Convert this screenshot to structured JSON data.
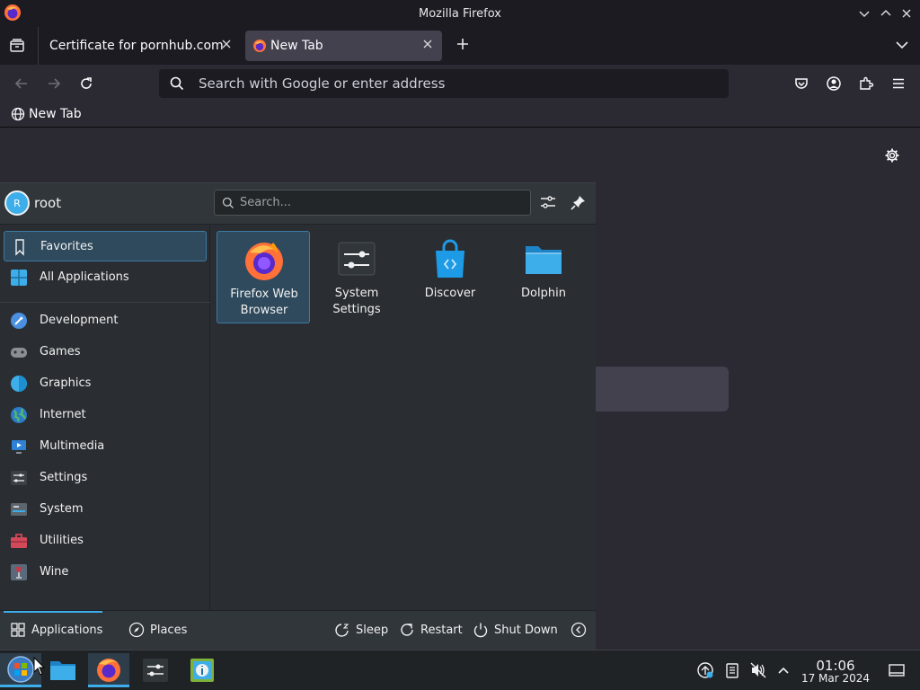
{
  "window": {
    "title": "Mozilla Firefox"
  },
  "tabs": [
    {
      "label": "Certificate for pornhub.com",
      "active": false
    },
    {
      "label": "New Tab",
      "active": true
    }
  ],
  "urlbar": {
    "placeholder": "Search with Google or enter address",
    "value": ""
  },
  "bookmarks": [
    {
      "label": "New Tab"
    }
  ],
  "launcher": {
    "user": {
      "initial": "R",
      "name": "root"
    },
    "search": {
      "placeholder": "Search..."
    },
    "categories": [
      {
        "label": "Favorites",
        "icon": "bookmark-icon",
        "selected": true
      },
      {
        "label": "All Applications",
        "icon": "grid-icon"
      },
      {
        "label": "Development",
        "icon": "development-icon"
      },
      {
        "label": "Games",
        "icon": "gamepad-icon"
      },
      {
        "label": "Graphics",
        "icon": "graphics-icon"
      },
      {
        "label": "Internet",
        "icon": "globe-icon"
      },
      {
        "label": "Multimedia",
        "icon": "multimedia-icon"
      },
      {
        "label": "Settings",
        "icon": "settings-icon"
      },
      {
        "label": "System",
        "icon": "system-icon"
      },
      {
        "label": "Utilities",
        "icon": "toolbox-icon"
      },
      {
        "label": "Wine",
        "icon": "wine-icon"
      }
    ],
    "favorites": [
      {
        "label": "Firefox Web Browser",
        "icon": "firefox-icon",
        "selected": true
      },
      {
        "label": "System Settings",
        "icon": "system-settings-icon"
      },
      {
        "label": "Discover",
        "icon": "discover-icon"
      },
      {
        "label": "Dolphin",
        "icon": "folder-icon"
      }
    ],
    "footer": {
      "applications": "Applications",
      "places": "Places",
      "sleep": "Sleep",
      "restart": "Restart",
      "shutdown": "Shut Down"
    }
  },
  "panel": {
    "clock": {
      "time": "01:06",
      "date": "17 Mar 2024"
    }
  },
  "colors": {
    "accent": "#3daee9",
    "firefox_toolbar": "#2b2a33",
    "firefox_tabstrip": "#1c1b22",
    "launcher_bg": "#2a2e32"
  }
}
